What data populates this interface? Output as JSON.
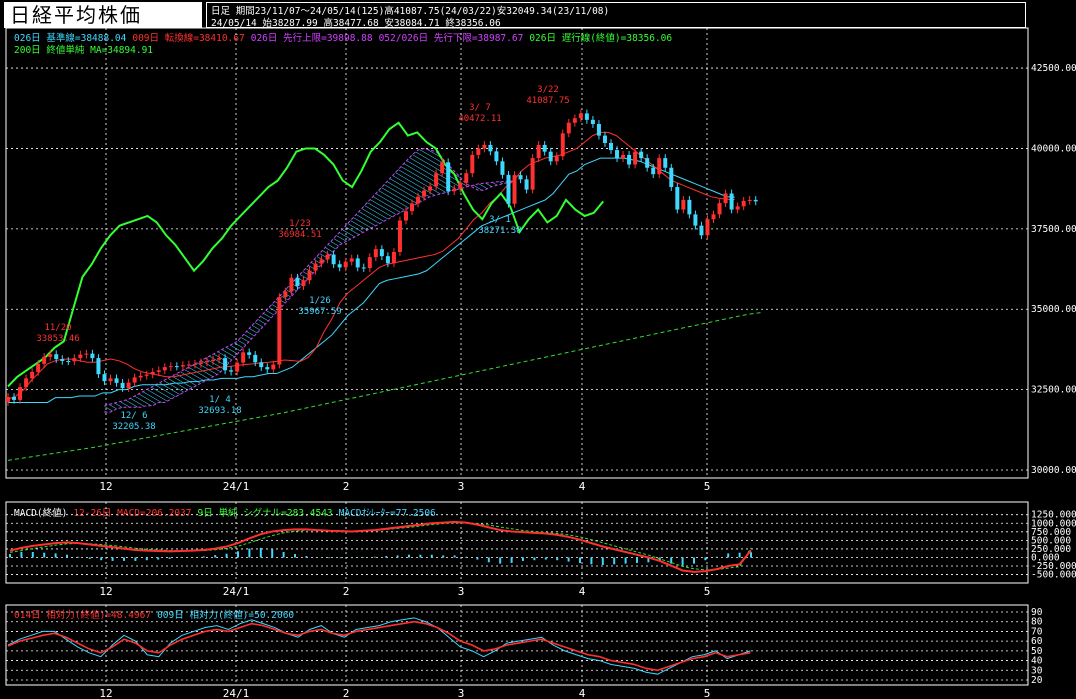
{
  "header": {
    "title": "日経平均株価",
    "info_line1": "日足 期間23/11/07～24/05/14(125)高41087.75(24/03/22)安32049.34(23/11/08)",
    "info_line2": "24/05/14    始38287.99 高38477.68 安38084.71 終38356.06"
  },
  "legend_main": [
    {
      "text": "026日 基準線=38488.04",
      "color": "#3fd8ff"
    },
    {
      "text": "009日 転換線=38410.67",
      "color": "#ff3030"
    },
    {
      "text": "026日 先行上限=39898.88",
      "color": "#d040ff"
    },
    {
      "text": "052/026日 先行下限=38987.67",
      "color": "#d040ff"
    },
    {
      "text": "026日 遅行線(終値)=38356.06",
      "color": "#33ff33"
    }
  ],
  "legend_main2": [
    {
      "text": "200日 終値単純 MA=34894.91",
      "color": "#33ff33"
    }
  ],
  "legend_macd": [
    {
      "text": "MACD(終値)",
      "color": "#ffffff"
    },
    {
      "text": "12-26日 MACD=206.2037",
      "color": "#ff3030"
    },
    {
      "text": "9日 単純 シグナル=283.4543",
      "color": "#33ff33"
    },
    {
      "text": "MACDｵｼﾚｰﾀｰ=77.2506",
      "color": "#3fd8ff"
    }
  ],
  "legend_rsi": [
    {
      "text": "014日 相対力(終値)=48.4967",
      "color": "#ff3030"
    },
    {
      "text": "009日 相対力(終値)=50.2060",
      "color": "#3fd8ff"
    }
  ],
  "colors": {
    "up": "#ff3030",
    "down": "#3fd8ff",
    "lagging": "#33ff33",
    "kumo": "#d040ff",
    "grid": "#ffffff"
  },
  "chart_data": [
    {
      "type": "candlestick",
      "title": "日経平均株価",
      "ylim": [
        30000,
        43000
      ],
      "y_ticks": [
        "42500.00",
        "40000.00",
        "37500.00",
        "35000.00",
        "32500.00",
        "30000.00"
      ],
      "x_ticks": [
        "12",
        "24/1",
        "2",
        "3",
        "4",
        "5"
      ],
      "annotations": [
        {
          "date": "11/20",
          "value": "33853.46"
        },
        {
          "date": "12/ 6",
          "value": "32205.38"
        },
        {
          "date": "1/ 4",
          "value": "32693.18"
        },
        {
          "date": "1/23",
          "value": "36984.51"
        },
        {
          "date": "1/26",
          "value": "35967.59"
        },
        {
          "date": "3/ 7",
          "value": "40472.11"
        },
        {
          "date": "3/ 1",
          "value": "38271.38"
        },
        {
          "date": "3/22",
          "value": "41087.75"
        }
      ],
      "close": [
        32270,
        32180,
        32580,
        32850,
        33050,
        33300,
        33520,
        33600,
        33450,
        33390,
        33380,
        33480,
        33590,
        33620,
        33480,
        32980,
        32760,
        32850,
        32710,
        32550,
        32720,
        32880,
        32930,
        32970,
        33050,
        33100,
        33200,
        33230,
        33220,
        33260,
        33280,
        33300,
        33350,
        33390,
        33430,
        33480,
        33100,
        33060,
        33340,
        33660,
        33580,
        33350,
        33200,
        33130,
        33280,
        35380,
        35550,
        35980,
        35720,
        35900,
        36200,
        36420,
        36550,
        36700,
        36400,
        36300,
        36480,
        36580,
        36300,
        36280,
        36620,
        36870,
        36650,
        36430,
        36780,
        37760,
        38050,
        38290,
        38500,
        38690,
        38820,
        39230,
        39570,
        38670,
        38750,
        38930,
        39230,
        39800,
        40000,
        40110,
        39910,
        39600,
        39180,
        38280,
        39170,
        39040,
        38720,
        39700,
        40110,
        39900,
        39600,
        39760,
        40470,
        40800,
        40940,
        41090,
        40890,
        40760,
        40400,
        40170,
        39950,
        39700,
        39800,
        39500,
        39900,
        39700,
        39400,
        39200,
        39700,
        39400,
        38800,
        38100,
        38400,
        37950,
        37600,
        37300,
        37800,
        37950,
        38300,
        38600,
        38100,
        38200,
        38370,
        38400,
        38356
      ],
      "ichimoku_base": [
        32100,
        32100,
        32100,
        32100,
        32100,
        32100,
        32250,
        32250,
        32250,
        32300,
        32300,
        32300,
        32400,
        32400,
        32500,
        32500,
        32600,
        32650,
        32650,
        32650,
        32650,
        32700,
        32700,
        32750,
        32750,
        32800,
        32800,
        32850,
        32850,
        32850,
        32900,
        32900,
        32950,
        33000,
        33000,
        33100,
        33200,
        33400,
        33600,
        33800,
        34000,
        34200,
        34500,
        34800,
        35000,
        35200,
        35500,
        35800,
        35900,
        35950,
        36000,
        36050,
        36100,
        36200,
        36400,
        36600,
        36800,
        37000,
        37200,
        37400,
        37600,
        37700,
        37800,
        37900,
        38000,
        38100,
        38200,
        38300,
        38400,
        38600,
        38900,
        39200,
        39300,
        39500,
        39600,
        39700,
        39700,
        39700,
        39700,
        39650,
        39600,
        39500,
        39400,
        39300,
        39200,
        39100,
        39000,
        38900,
        38800,
        38700,
        38600,
        38500,
        38488
      ],
      "ichimoku_conversion": [
        32200,
        32300,
        32500,
        32800,
        33050,
        33300,
        33400,
        33450,
        33450,
        33400,
        33350,
        33350,
        33400,
        33450,
        33400,
        33300,
        33150,
        33050,
        33000,
        32950,
        32900,
        32900,
        32950,
        33000,
        33050,
        33100,
        33150,
        33200,
        33220,
        33250,
        33280,
        33300,
        33330,
        33350,
        33380,
        33420,
        33400,
        33380,
        33500,
        33800,
        34300,
        34700,
        35200,
        35500,
        35700,
        35900,
        36100,
        36300,
        36400,
        36450,
        36500,
        36550,
        36600,
        36650,
        36700,
        36800,
        37000,
        37200,
        37500,
        37800,
        38000,
        38300,
        38500,
        38800,
        39000,
        39300,
        39500,
        39600,
        39700,
        39750,
        39800,
        39900,
        40000,
        40200,
        40400,
        40500,
        40500,
        40400,
        40200,
        40000,
        39800,
        39600,
        39400,
        39200,
        39000,
        38900,
        38800,
        38700,
        38600,
        38500,
        38450,
        38420,
        38410
      ],
      "senkou_a": [
        32000,
        32050,
        32100,
        32150,
        32200,
        32300,
        32400,
        32500,
        32600,
        32700,
        32800,
        32900,
        33000,
        33100,
        33200,
        33300,
        33400,
        33500,
        33600,
        33700,
        33800,
        33900,
        34000,
        34200,
        34400,
        34600,
        34800,
        35000,
        35200,
        35400,
        35600,
        35800,
        36000,
        36200,
        36400,
        36600,
        36800,
        37000,
        37200,
        37400,
        37600,
        37800,
        38000,
        38200,
        38400,
        38600,
        38800,
        39000,
        39200,
        39400,
        39600,
        39800,
        39950,
        40000,
        39950,
        39900,
        39700,
        39500,
        39300,
        39100,
        38900,
        38800,
        38700,
        38700,
        38800,
        38850,
        38900,
        38950,
        39000
      ],
      "senkou_b": [
        31800,
        31800,
        31900,
        31950,
        31950,
        31950,
        31950,
        32000,
        32000,
        32100,
        32100,
        32200,
        32300,
        32400,
        32500,
        32600,
        32700,
        32800,
        32900,
        33000,
        33200,
        33400,
        33600,
        33800,
        34000,
        34200,
        34400,
        34600,
        34800,
        35000,
        35200,
        35400,
        35600,
        35800,
        36000,
        36200,
        36400,
        36600,
        36800,
        37000,
        37100,
        37200,
        37300,
        37400,
        37500,
        37600,
        37700,
        37800,
        37900,
        38000,
        38100,
        38200,
        38300,
        38400,
        38500,
        38550,
        38600,
        38650,
        38700,
        38750,
        38800,
        38850,
        38900,
        38920,
        38940,
        38960,
        38970,
        38980,
        38987
      ],
      "lagging": [
        32600,
        32900,
        33100,
        33300,
        33500,
        33800,
        34000,
        35000,
        36000,
        36400,
        36900,
        37300,
        37600,
        37700,
        37800,
        37900,
        37700,
        37300,
        37000,
        36600,
        36200,
        36500,
        36900,
        37200,
        37600,
        37900,
        38200,
        38500,
        38800,
        39000,
        39400,
        39900,
        40000,
        40000,
        39800,
        39500,
        39000,
        38800,
        39300,
        39900,
        40200,
        40600,
        40800,
        40400,
        40500,
        40200,
        40000,
        39500,
        39200,
        38600,
        38100,
        37800,
        38300,
        38600,
        38200,
        37400,
        37800,
        38100,
        37700,
        37900,
        38400,
        38100,
        37900,
        38000,
        38356
      ],
      "ma200": [
        30300,
        30350,
        30400,
        30450,
        30500,
        30550,
        30600,
        30650,
        30700,
        30760,
        30820,
        30880,
        30940,
        31000,
        31060,
        31120,
        31180,
        31240,
        31300,
        31360,
        31420,
        31480,
        31540,
        31600,
        31660,
        31720,
        31780,
        31850,
        31920,
        31990,
        32060,
        32130,
        32200,
        32270,
        32340,
        32410,
        32480,
        32550,
        32620,
        32690,
        32760,
        32830,
        32900,
        32970,
        33040,
        33110,
        33180,
        33250,
        33320,
        33390,
        33460,
        33530,
        33600,
        33670,
        33740,
        33810,
        33880,
        33950,
        34020,
        34090,
        34160,
        34230,
        34300,
        34370,
        34440,
        34510,
        34580,
        34650,
        34720,
        34790,
        34850,
        34894
      ]
    },
    {
      "type": "line",
      "title": "MACD(終値)",
      "ylim": [
        -600,
        1300
      ],
      "y_ticks": [
        "1250.000",
        "1000.000",
        "750.000",
        "500.000",
        "250.000",
        "0.000",
        "-250.000",
        "-500.000"
      ],
      "x_ticks": [
        "12",
        "24/1",
        "2",
        "3",
        "4",
        "5"
      ],
      "series": [
        {
          "name": "MACD",
          "values": [
            200,
            280,
            340,
            380,
            420,
            440,
            420,
            380,
            340,
            300,
            260,
            220,
            200,
            190,
            180,
            190,
            200,
            220,
            260,
            320,
            420,
            560,
            680,
            760,
            800,
            820,
            820,
            800,
            780,
            770,
            760,
            780,
            800,
            840,
            880,
            920,
            960,
            1000,
            1020,
            1040,
            1020,
            960,
            880,
            800,
            760,
            740,
            720,
            700,
            660,
            600,
            520,
            420,
            320,
            240,
            160,
            80,
            0,
            -100,
            -240,
            -380,
            -420,
            -400,
            -340,
            -250,
            -200,
            206
          ]
        },
        {
          "name": "シグナル",
          "values": [
            150,
            200,
            260,
            310,
            360,
            400,
            410,
            400,
            380,
            350,
            310,
            270,
            240,
            220,
            200,
            195,
            195,
            205,
            225,
            265,
            330,
            430,
            540,
            640,
            720,
            770,
            800,
            800,
            790,
            780,
            770,
            775,
            790,
            820,
            850,
            880,
            920,
            960,
            990,
            1010,
            1010,
            990,
            950,
            890,
            840,
            790,
            760,
            730,
            700,
            660,
            600,
            520,
            430,
            340,
            250,
            160,
            70,
            -40,
            -150,
            -260,
            -330,
            -360,
            -350,
            -310,
            -270,
            283
          ]
        },
        {
          "name": "MACDｵｼﾚｰﾀｰ",
          "values": [
            50,
            80,
            80,
            70,
            60,
            40,
            10,
            -20,
            -40,
            -50,
            -50,
            -50,
            -40,
            -30,
            -20,
            -5,
            5,
            15,
            35,
            55,
            90,
            130,
            140,
            120,
            80,
            50,
            20,
            0,
            -10,
            -10,
            -10,
            5,
            10,
            20,
            30,
            40,
            40,
            40,
            30,
            30,
            10,
            -30,
            -70,
            -90,
            -80,
            -50,
            -40,
            -30,
            -40,
            -60,
            -80,
            -100,
            -110,
            -100,
            -90,
            -80,
            -70,
            -60,
            -90,
            -120,
            -90,
            -40,
            10,
            60,
            70,
            77
          ]
        }
      ]
    },
    {
      "type": "line",
      "title": "相対力(終値)",
      "ylim": [
        20,
        90
      ],
      "y_ticks": [
        "90",
        "80",
        "70",
        "60",
        "50",
        "40",
        "30",
        "20"
      ],
      "x_ticks": [
        "12",
        "24/1",
        "2",
        "3",
        "4",
        "5"
      ],
      "series": [
        {
          "name": "014日 相対力",
          "values": [
            55,
            60,
            63,
            66,
            68,
            64,
            58,
            52,
            48,
            54,
            62,
            58,
            50,
            48,
            56,
            62,
            66,
            70,
            72,
            70,
            74,
            78,
            76,
            72,
            68,
            66,
            70,
            72,
            68,
            66,
            70,
            72,
            74,
            76,
            78,
            80,
            78,
            74,
            68,
            60,
            56,
            50,
            52,
            56,
            58,
            60,
            62,
            58,
            54,
            50,
            46,
            44,
            40,
            38,
            36,
            32,
            30,
            34,
            38,
            42,
            44,
            48,
            44,
            46,
            48
          ]
        },
        {
          "name": "009日 相対力",
          "values": [
            56,
            62,
            66,
            70,
            70,
            62,
            54,
            48,
            44,
            56,
            66,
            60,
            46,
            44,
            58,
            66,
            70,
            74,
            76,
            72,
            78,
            82,
            78,
            74,
            68,
            64,
            72,
            76,
            68,
            64,
            72,
            74,
            76,
            80,
            82,
            84,
            80,
            74,
            64,
            54,
            50,
            44,
            50,
            58,
            60,
            62,
            64,
            56,
            50,
            46,
            42,
            40,
            36,
            34,
            32,
            28,
            26,
            32,
            38,
            44,
            46,
            50,
            42,
            46,
            50
          ]
        }
      ]
    }
  ]
}
